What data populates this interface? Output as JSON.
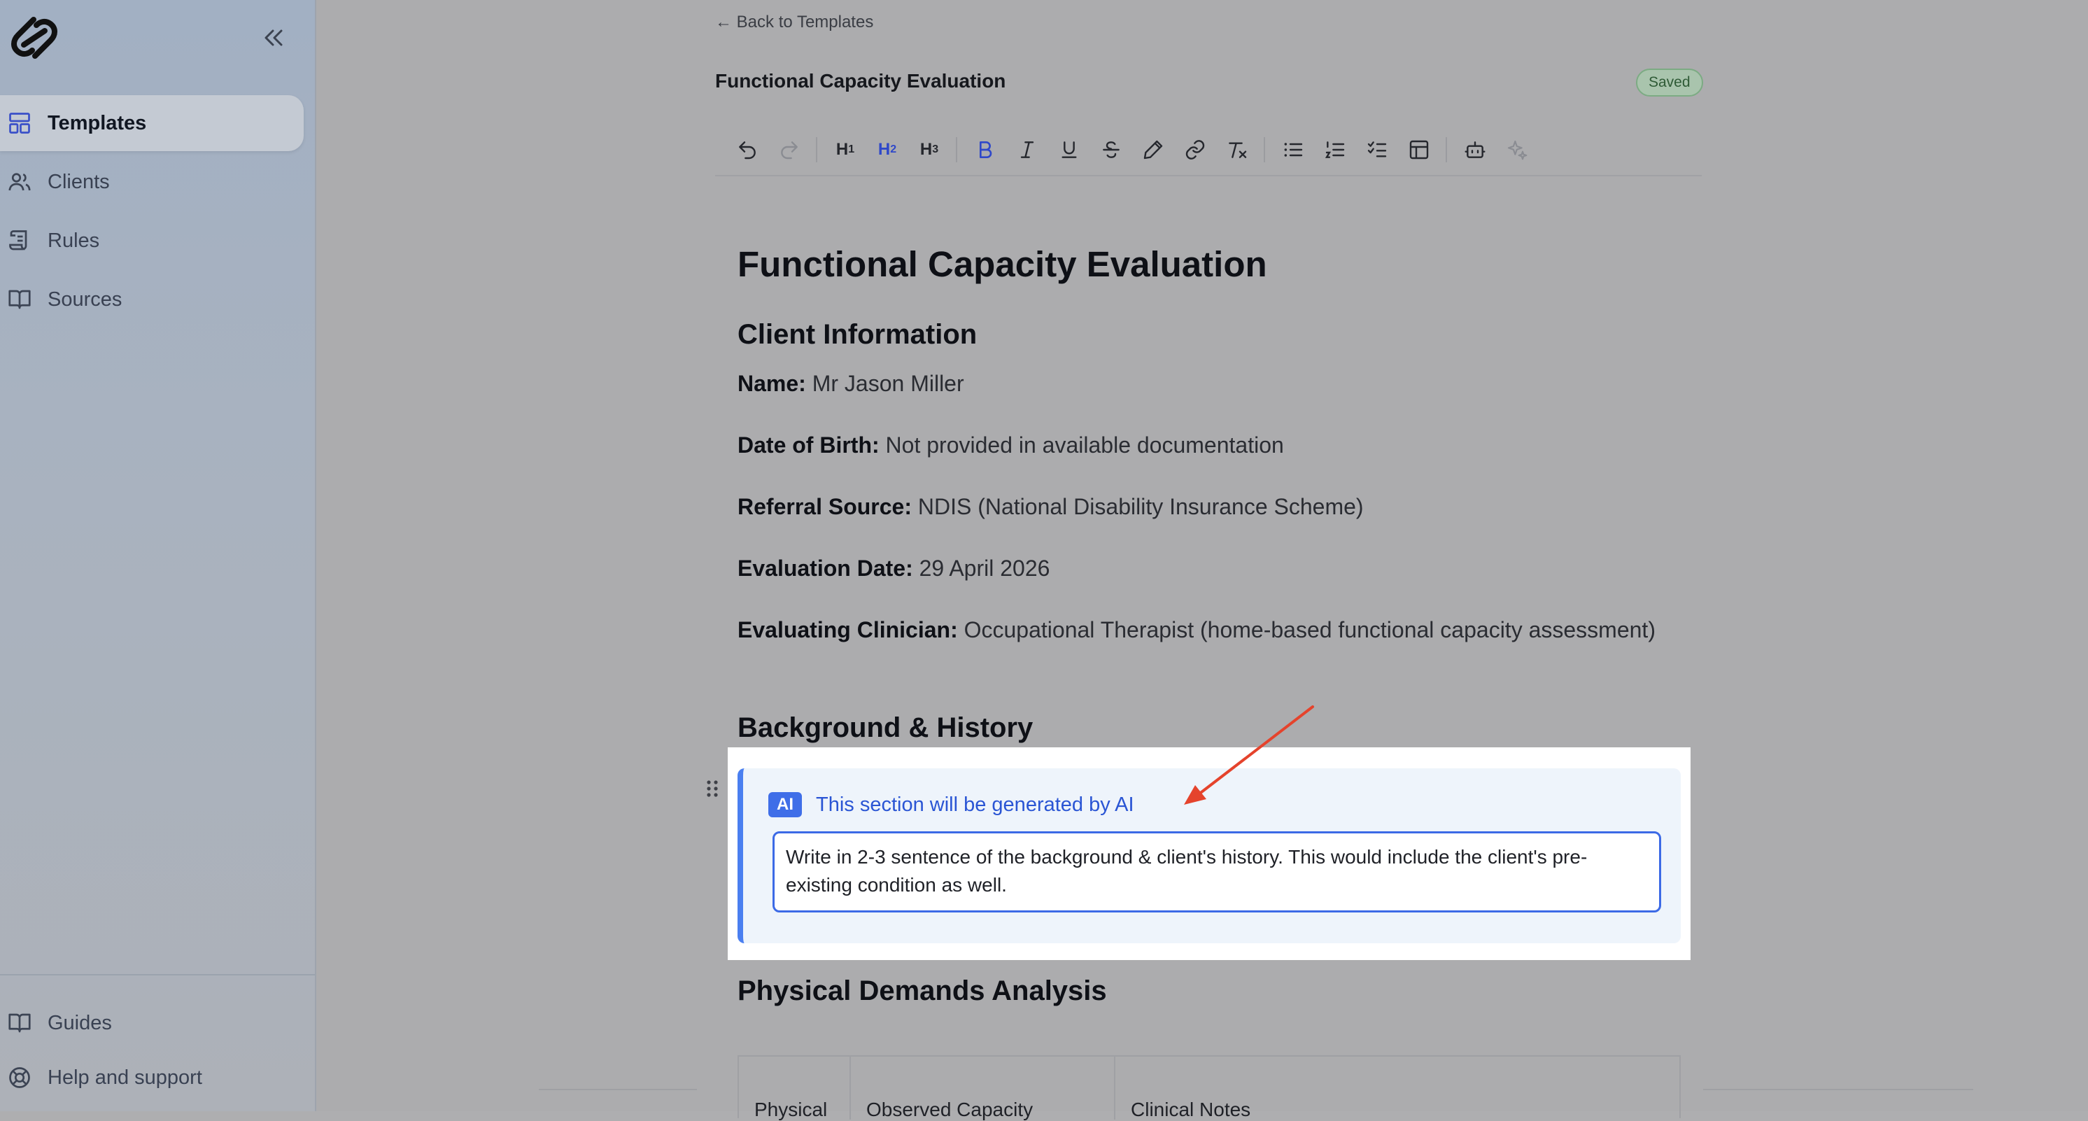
{
  "sidebar": {
    "collapse_icon": "chevrons-left-icon",
    "nav": [
      {
        "label": "Templates",
        "icon": "layout-icon",
        "active": true
      },
      {
        "label": "Clients",
        "icon": "users-icon"
      },
      {
        "label": "Rules",
        "icon": "scroll-icon"
      },
      {
        "label": "Sources",
        "icon": "book-open-icon"
      }
    ],
    "footer": [
      {
        "label": "Guides",
        "icon": "book-open-icon"
      },
      {
        "label": "Help and support",
        "icon": "life-buoy-icon"
      }
    ]
  },
  "header": {
    "back_label": "← Back to Templates",
    "title": "Functional Capacity Evaluation",
    "status": "Saved"
  },
  "toolbar": {
    "h1": "H",
    "h1_sub": "1",
    "h2": "H",
    "h2_sub": "2",
    "h3": "H",
    "h3_sub": "3"
  },
  "document": {
    "title": "Functional Capacity Evaluation",
    "sections": {
      "client_info": "Client Information",
      "background": "Background & History",
      "physical": "Physical Demands Analysis"
    },
    "fields": [
      {
        "label": "Name:",
        "value": "Mr Jason Miller"
      },
      {
        "label": "Date of Birth:",
        "value": "Not provided in available documentation"
      },
      {
        "label": "Referral Source:",
        "value": "NDIS (National Disability Insurance Scheme)"
      },
      {
        "label": "Evaluation Date:",
        "value": "29 April 2026"
      },
      {
        "label": "Evaluating Clinician:",
        "value": "Occupational Therapist (home-based functional capacity assessment)"
      }
    ],
    "ai_block": {
      "badge": "AI",
      "heading": "This section will be generated by AI",
      "prompt": "Write in 2-3 sentence of the background & client's history. This would include the client's pre-existing condition as well."
    },
    "table_headers": [
      "Physical",
      "Observed Capacity",
      "Clinical Notes"
    ]
  },
  "colors": {
    "accent": "#3f6ee8",
    "annotation_arrow": "#e5432c",
    "saved_green": "#2f5a36"
  }
}
